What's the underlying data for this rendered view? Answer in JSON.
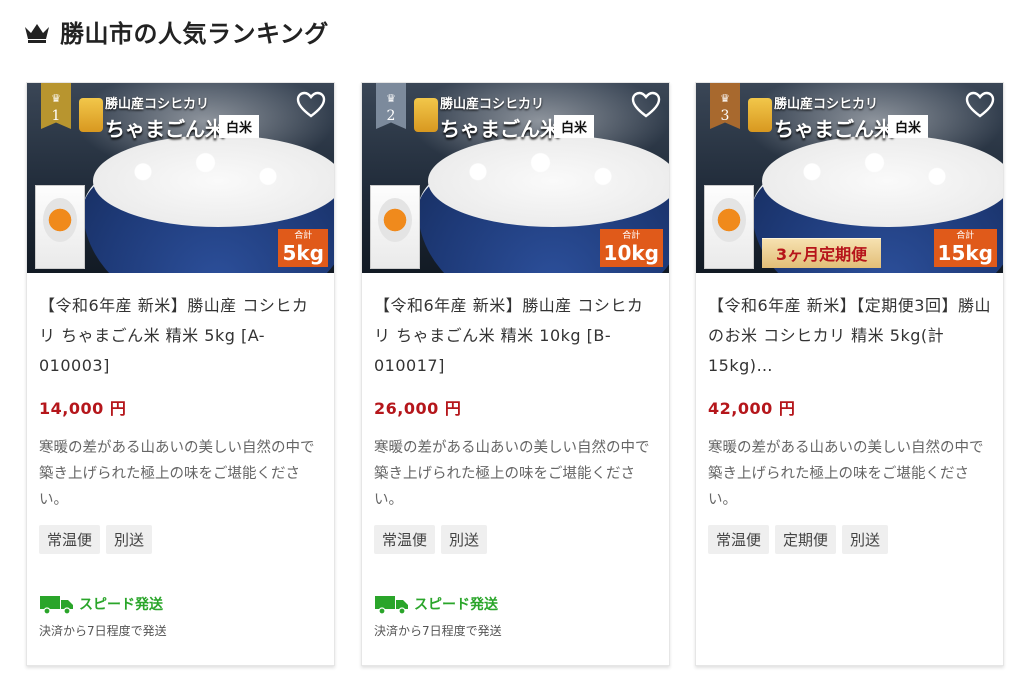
{
  "header": {
    "title": "勝山市の人気ランキング",
    "icon": "crown-icon"
  },
  "colors": {
    "price": "#b5161b",
    "speed": "#2aa52a",
    "rank_gold": "#b8952f",
    "rank_silver": "#7c8a9c",
    "rank_bronze": "#a8692e",
    "weight_badge": "#e05a1a"
  },
  "image_text": {
    "brand_line1": "勝山産コシヒカリ",
    "brand_line2": "ちゃまごん米",
    "hakumai": "白米",
    "total_label": "合計"
  },
  "cards": [
    {
      "rank": "1",
      "weight": "5kg",
      "title": "【令和6年産 新米】勝山産 コシヒカリ ちゃまごん米 精米 5kg [A-010003]",
      "price": "14,000 円",
      "description": "寒暖の差がある山あいの美しい自然の中で築き上げられた極上の味をご堪能ください。",
      "tags": [
        "常温便",
        "別送"
      ],
      "speed_label": "スピード発送",
      "ship_note": "決済から7日程度で発送"
    },
    {
      "rank": "2",
      "weight": "10kg",
      "title": "【令和6年産 新米】勝山産 コシヒカリ ちゃまごん米 精米 10kg [B-010017]",
      "price": "26,000 円",
      "description": "寒暖の差がある山あいの美しい自然の中で築き上げられた極上の味をご堪能ください。",
      "tags": [
        "常温便",
        "別送"
      ],
      "speed_label": "スピード発送",
      "ship_note": "決済から7日程度で発送"
    },
    {
      "rank": "3",
      "weight": "15kg",
      "banner": "3ヶ月定期便",
      "title": "【令和6年産 新米】【定期便3回】勝山のお米 コシヒカリ 精米 5kg(計15kg)…",
      "price": "42,000 円",
      "description": "寒暖の差がある山あいの美しい自然の中で築き上げられた極上の味をご堪能ください。",
      "tags": [
        "常温便",
        "定期便",
        "別送"
      ]
    }
  ]
}
